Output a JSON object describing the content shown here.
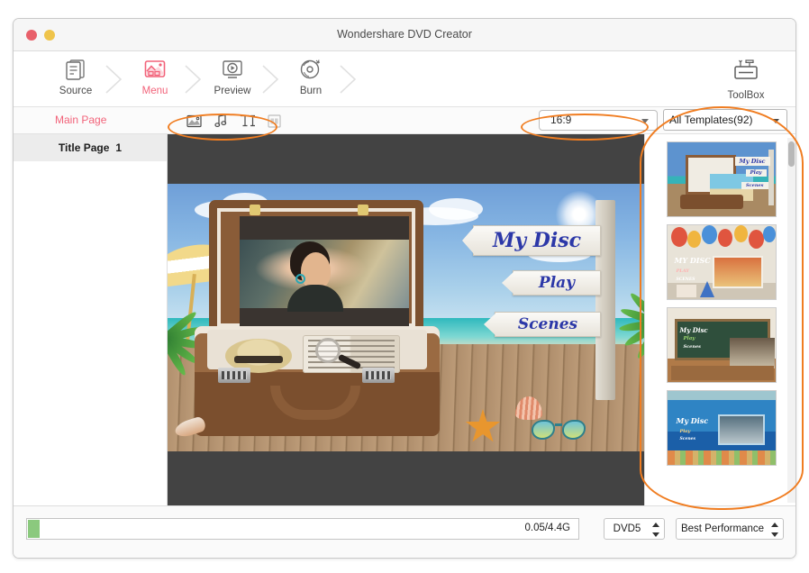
{
  "window": {
    "title": "Wondershare DVD Creator",
    "traffic_lights": [
      "close-red",
      "minimize-yellow"
    ]
  },
  "steps": [
    {
      "id": "source",
      "label": "Source",
      "icon": "documents-icon",
      "active": false
    },
    {
      "id": "menu",
      "label": "Menu",
      "icon": "image-menu-icon",
      "active": true
    },
    {
      "id": "preview",
      "label": "Preview",
      "icon": "monitor-play-icon",
      "active": false
    },
    {
      "id": "burn",
      "label": "Burn",
      "icon": "disc-burn-icon",
      "active": false
    }
  ],
  "toolbox": {
    "label": "ToolBox",
    "icon": "toolbox-icon"
  },
  "controls": {
    "main_page_tab": "Main Page",
    "menu_tools": [
      {
        "id": "background",
        "icon": "image-icon",
        "enabled": true
      },
      {
        "id": "music",
        "icon": "music-note-icon",
        "enabled": true
      },
      {
        "id": "text",
        "icon": "text-ti-icon",
        "enabled": true
      },
      {
        "id": "chapters",
        "icon": "grid-thumbnail-icon",
        "enabled": false
      }
    ],
    "aspect_ratio": {
      "value": "16:9",
      "icon": "chevron-down-icon"
    },
    "template_filter": {
      "value": "All Templates(92)",
      "icon": "chevron-down-icon"
    }
  },
  "page_list": {
    "items": [
      {
        "label": "Title Page",
        "number": "1",
        "selected": true
      }
    ]
  },
  "preview": {
    "menu_title": "My Disc",
    "play_label": "Play",
    "scenes_label": "Scenes",
    "theme": "beach-suitcase"
  },
  "templates": [
    {
      "id": "tpl-beach",
      "name": "Beach Suitcase",
      "title": "My Disc",
      "play": "Play",
      "scenes": "Scenes",
      "selected": true
    },
    {
      "id": "tpl-birthday",
      "name": "Birthday Party",
      "title": "MY DISC",
      "play": "PLAY",
      "scenes": "SCENES",
      "selected": false
    },
    {
      "id": "tpl-classroom",
      "name": "Classroom",
      "title": "My Disc",
      "play": "Play",
      "scenes": "Scenes",
      "selected": false
    },
    {
      "id": "tpl-underwater",
      "name": "Underwater",
      "title": "My Disc",
      "play": "Play",
      "scenes": "Scenes",
      "selected": false
    }
  ],
  "footer": {
    "progress_text": "0.05/4.4G",
    "progress_percent": 2,
    "disc_type": "DVD5",
    "quality": "Best Performance"
  },
  "colors": {
    "accent_pink": "#f2637a",
    "annotation_orange": "#f07d21",
    "progress_green": "#8bc97e",
    "sign_blue": "#2c38a8"
  }
}
